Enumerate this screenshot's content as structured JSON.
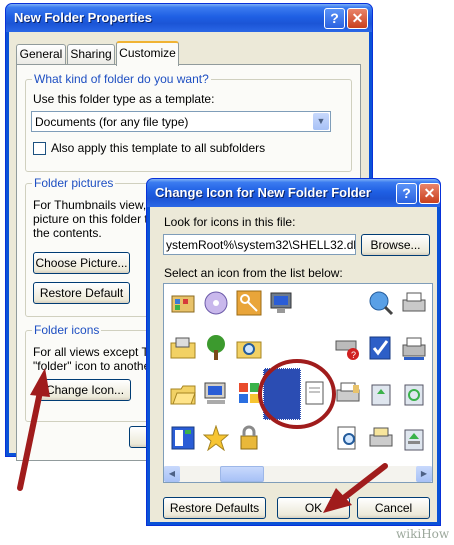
{
  "properties_window": {
    "title": "New Folder Properties",
    "tabs": [
      "General",
      "Sharing",
      "Customize"
    ],
    "active_tab": "Customize",
    "folder_type_group": {
      "label": "What kind of folder do you want?",
      "template_label": "Use this folder type as a template:",
      "template_value": "Documents (for any file type)",
      "apply_subfolders_label": "Also apply this template to all subfolders",
      "apply_subfolders_checked": false
    },
    "folder_pictures_group": {
      "label": "Folder pictures",
      "description_1": "For Thumbnails view, y",
      "description_2": "picture on this folder to",
      "description_3": "the contents.",
      "choose_picture": "Choose Picture...",
      "restore_default": "Restore Default"
    },
    "folder_icons_group": {
      "label": "Folder icons",
      "description_1": "For all views except Th",
      "description_2": "\"folder\" icon to another",
      "change_icon": "Change Icon..."
    }
  },
  "change_icon_dialog": {
    "title": "Change Icon for New Folder Folder",
    "look_for_label": "Look for icons in this file:",
    "file_path": "ystemRoot%\\system32\\SHELL32.dll",
    "browse": "Browse...",
    "select_label": "Select an icon from the list below:",
    "restore_defaults": "Restore Defaults",
    "ok": "OK",
    "cancel": "Cancel"
  },
  "icons": {
    "row1": [
      "control-panel-icon",
      "cd-audio-icon",
      "key-icon",
      "computer-program-icon",
      "blank-icon",
      "blank-icon",
      "globe-search-icon",
      "printer-icon"
    ],
    "row2": [
      "printer-folder-icon",
      "tree-icon",
      "search-folder-icon",
      "blank-icon",
      "blank-icon",
      "remove-drive-icon",
      "checklist-icon",
      "network-printer-icon"
    ],
    "row3": [
      "open-folder-icon",
      "computer-icon",
      "windows-logo-icon",
      "selected-blank-icon",
      "document-icon",
      "fax-printer-icon",
      "recycle-bin-full-icon",
      "recycle-bin-icon"
    ],
    "row4": [
      "start-menu-icon",
      "star-icon",
      "lock-icon",
      "blank-icon",
      "blank-icon",
      "find-document-icon",
      "image-printer-icon",
      "recycle-full-icon"
    ]
  },
  "colors": {
    "selection_blue": "#2b4db3",
    "annotation_red": "#a01c1c",
    "xp_title_blue": "#1f5fe4"
  },
  "watermark": "wikiHow"
}
